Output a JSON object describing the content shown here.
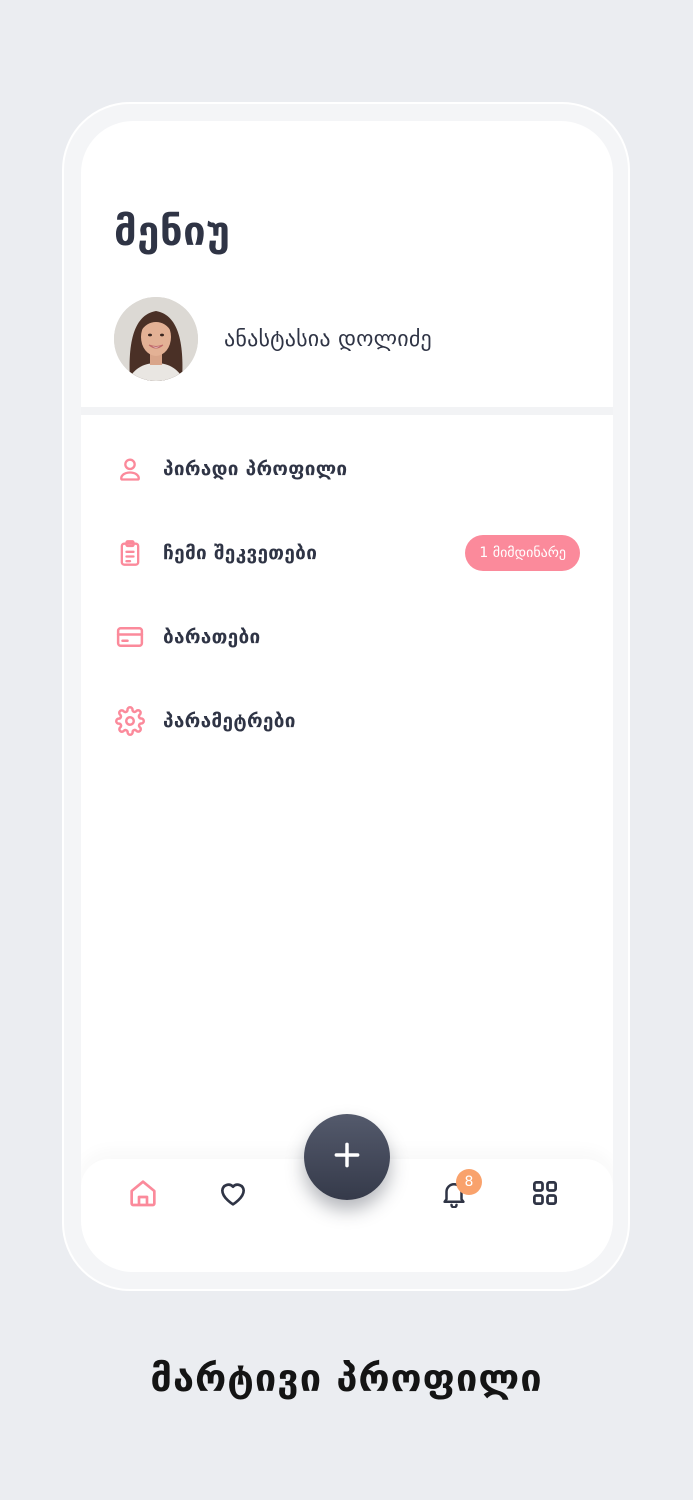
{
  "menu": {
    "title": "მენიუ"
  },
  "profile": {
    "name": "ანასტასია დოლიძე"
  },
  "menu_items": [
    {
      "label": "პირადი პროფილი",
      "icon": "user-icon"
    },
    {
      "label": "ჩემი შეკვეთები",
      "icon": "clipboard-icon",
      "badge": "1 მიმდინარე"
    },
    {
      "label": "ბარათები",
      "icon": "credit-card-icon"
    },
    {
      "label": "პარამეტრები",
      "icon": "gear-icon"
    }
  ],
  "tabbar": {
    "items": [
      "home-icon",
      "heart-icon",
      "plus-icon",
      "bell-icon",
      "grid-icon"
    ],
    "notification_count": "8"
  },
  "caption": "მარტივი პროფილი",
  "colors": {
    "accent": "#fb8a9b",
    "dark": "#2f3445",
    "badge_orange": "#f9a26c",
    "background": "#ebedf1"
  }
}
